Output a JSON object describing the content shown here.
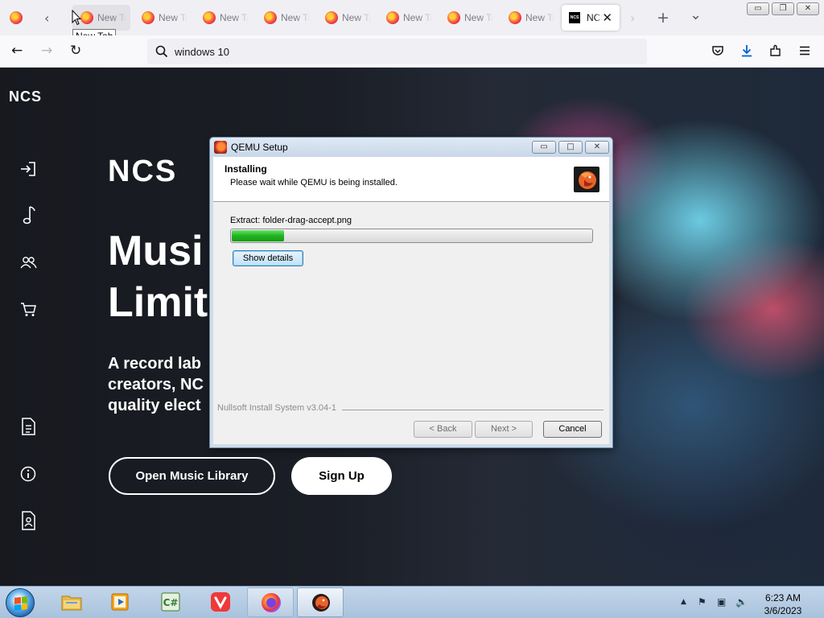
{
  "browser": {
    "tabs": [
      {
        "title": "New Tab",
        "kind": "firefox"
      },
      {
        "title": "New Tab",
        "kind": "firefox"
      },
      {
        "title": "New Tab",
        "kind": "firefox"
      },
      {
        "title": "New Tab",
        "kind": "firefox"
      },
      {
        "title": "New Tab",
        "kind": "firefox"
      },
      {
        "title": "New Tab",
        "kind": "firefox"
      },
      {
        "title": "New Tab",
        "kind": "firefox"
      },
      {
        "title": "New Tab",
        "kind": "firefox"
      },
      {
        "title": "NCS",
        "kind": "ncs",
        "active": true
      }
    ],
    "tooltip": "New Tab",
    "new_tab_glyph": "+",
    "list_all_tabs_glyph": "⌄",
    "url_text": "windows 10",
    "favicon_text": "NCS",
    "window_controls": {
      "minimize": "▭",
      "restore": "❐",
      "close": "✕"
    }
  },
  "page": {
    "sidebar_logo": "NCS",
    "hero_logo": "NCS",
    "title_line1": "Musi",
    "title_line2": "Limit",
    "subtitle_line1": "A record lab",
    "subtitle_line2": "creators, NC",
    "subtitle_line3": "quality elect",
    "primary_button": "Open Music Library",
    "secondary_button": "Sign Up",
    "sidebar_icons": [
      "login-icon",
      "music-note-icon",
      "users-icon",
      "cart-icon",
      "document-icon",
      "info-icon",
      "profile-document-icon"
    ]
  },
  "dialog": {
    "title": "QEMU Setup",
    "heading": "Installing",
    "subheading": "Please wait while QEMU is being installed.",
    "extract_text": "Extract: folder-drag-accept.png",
    "progress_percent": 14.5,
    "show_details": "Show details",
    "branding": "Nullsoft Install System v3.04-1",
    "back": "< Back",
    "next": "Next >",
    "cancel": "Cancel",
    "controls": {
      "minimize": "▭",
      "maximize": "□",
      "close": "✕"
    }
  },
  "taskbar": {
    "time": "6:23 AM",
    "date": "3/6/2023",
    "items": [
      "file-explorer",
      "media-player",
      "csharp-ide",
      "vivaldi",
      "firefox",
      "qemu-setup"
    ],
    "tray_glyphs": {
      "expand": "▲",
      "flag": "⚑",
      "network": "▣",
      "volume": "🔈"
    }
  },
  "colors": {
    "ncs_bg": "#17191f",
    "progress_green": "#1fb51f",
    "taskbar": "#b7cde4",
    "dialog_frame": "#cfdbe8"
  }
}
